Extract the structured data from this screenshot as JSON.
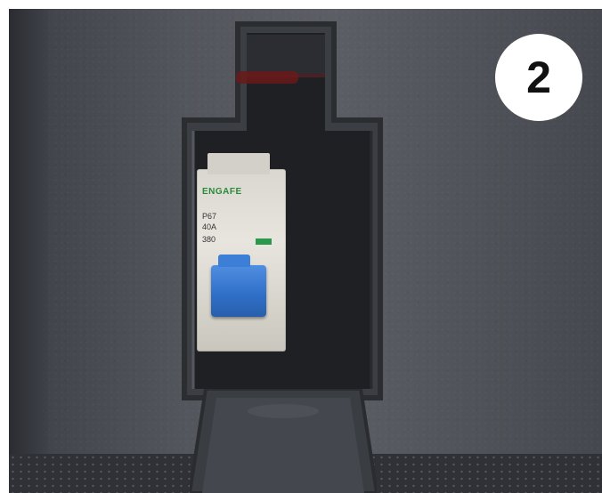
{
  "image": {
    "subject": "circuit breaker in wall compartment",
    "description": "Open wall compartment with a small flip-down cover revealing a white circuit breaker with a blue toggle"
  },
  "breaker": {
    "brand_text": "ENGAFE",
    "line1": "P67",
    "line2": "40A",
    "line3": "380"
  },
  "step_badge": {
    "number": "2"
  },
  "colors": {
    "panel": "#54575d",
    "toggle": "#2f6ec7",
    "badge_bg": "#ffffff",
    "badge_text": "#111111"
  }
}
